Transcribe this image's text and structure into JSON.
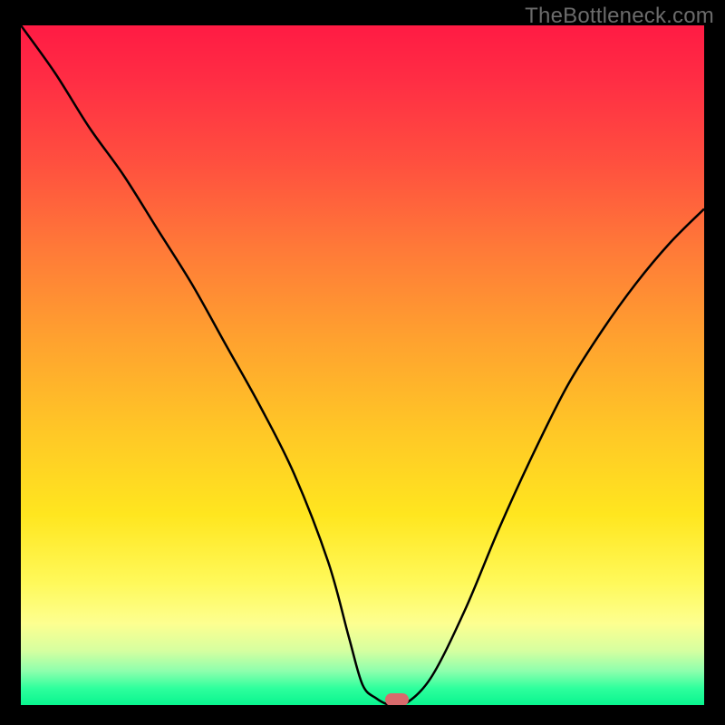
{
  "watermark": "TheBottleneck.com",
  "colors": {
    "frame_bg": "#000000",
    "watermark_text": "#6b6b6b",
    "curve_stroke": "#000000",
    "marker_fill": "#d86a6c",
    "gradient_stops": [
      "#ff1b44",
      "#ff2d44",
      "#ff4f3f",
      "#ff7a38",
      "#ffa12f",
      "#ffc826",
      "#ffe61f",
      "#fff95a",
      "#fdff90",
      "#d6ffa0",
      "#8dffad",
      "#2fff9d",
      "#09f58f"
    ]
  },
  "chart_data": {
    "type": "line",
    "title": "",
    "xlabel": "",
    "ylabel": "",
    "xlim": [
      0,
      100
    ],
    "ylim": [
      0,
      100
    ],
    "series": [
      {
        "name": "bottleneck-curve",
        "x": [
          0,
          5,
          10,
          15,
          20,
          25,
          30,
          35,
          40,
          45,
          48,
          50,
          52,
          54,
          56,
          60,
          65,
          70,
          75,
          80,
          85,
          90,
          95,
          100
        ],
        "values": [
          100,
          93,
          85,
          78,
          70,
          62,
          53,
          44,
          34,
          21,
          10,
          3,
          1,
          0,
          0,
          4,
          14,
          26,
          37,
          47,
          55,
          62,
          68,
          73
        ]
      }
    ],
    "annotations": [
      {
        "name": "minimum-marker",
        "x": 55,
        "y": 0
      }
    ]
  }
}
